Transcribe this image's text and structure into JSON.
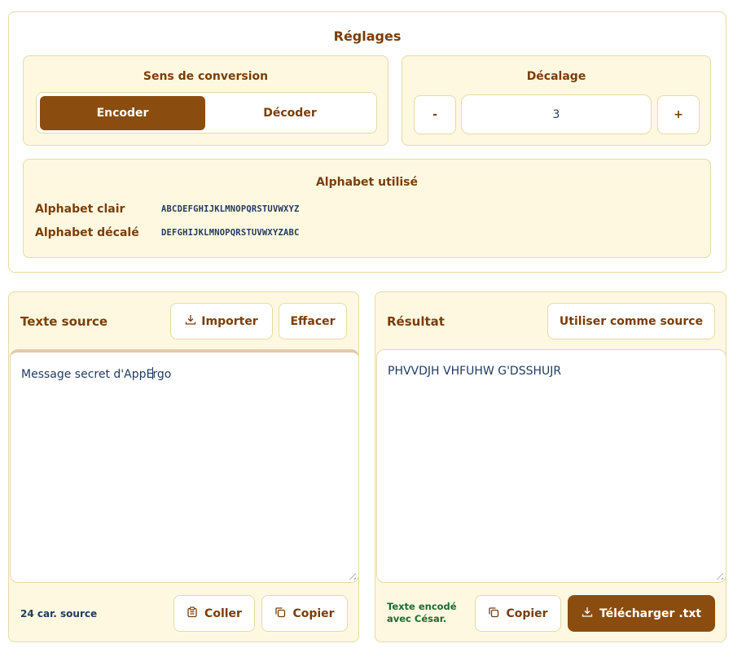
{
  "settings": {
    "title": "Réglages",
    "direction": {
      "title": "Sens de conversion",
      "encode_label": "Encoder",
      "decode_label": "Décoder",
      "selected": "Encoder"
    },
    "shift": {
      "title": "Décalage",
      "minus_label": "-",
      "value": "3",
      "plus_label": "+"
    },
    "alphabet": {
      "title": "Alphabet utilisé",
      "plain_label": "Alphabet clair",
      "plain_value": "ABCDEFGHIJKLMNOPQRSTUVWXYZ",
      "shifted_label": "Alphabet décalé",
      "shifted_value": "DEFGHIJKLMNOPQRSTUVWXYZABC"
    }
  },
  "source": {
    "title": "Texte source",
    "import_label": "Importer",
    "clear_label": "Effacer",
    "text_before_caret": "Message secret d'AppE",
    "text_after_caret": "rgo",
    "char_count": "24 car. source",
    "paste_label": "Coller",
    "copy_label": "Copier"
  },
  "result": {
    "title": "Résultat",
    "use_as_source_label": "Utiliser comme source",
    "text": "PHVVDJH VHFUHW G'DSSHUJR",
    "status": "Texte encodé avec César.",
    "copy_label": "Copier",
    "download_label": "Télécharger .txt"
  },
  "icons": {
    "import": "download-tray-icon",
    "paste": "clipboard-icon",
    "copy": "copy-icon",
    "download": "download-tray-icon"
  },
  "colors": {
    "accent": "#8a4d0f",
    "heading": "#7a3e06",
    "panel_bg": "#fff8e1",
    "border": "#e8d9a6",
    "text": "#1e3a5f",
    "success": "#1e6b2e"
  }
}
